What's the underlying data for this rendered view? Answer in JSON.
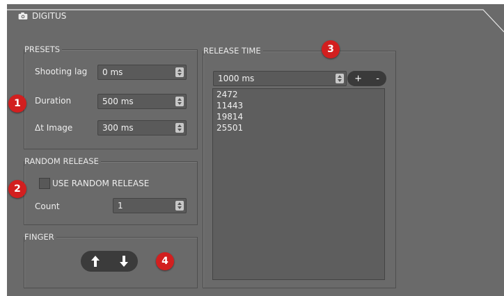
{
  "window": {
    "title": "DIGITUS",
    "title_icon": "camera-icon"
  },
  "presets": {
    "label": "PRESETS",
    "rows": [
      {
        "label": "Shooting lag",
        "value": "0 ms"
      },
      {
        "label": "Duration",
        "value": "500 ms"
      },
      {
        "label": "Δt Image",
        "value": "300 ms"
      }
    ]
  },
  "random_release": {
    "label": "RANDOM RELEASE",
    "checkbox_label": "USE RANDOM RELEASE",
    "checked": false,
    "count_label": "Count",
    "count_value": "1"
  },
  "finger": {
    "label": "FINGER",
    "up_icon": "arrow-up-icon",
    "down_icon": "arrow-down-icon"
  },
  "release_time": {
    "label": "RELEASE TIME",
    "value": "1000 ms",
    "add_label": "+",
    "remove_label": "-",
    "items": [
      "2472",
      "11443",
      "19814",
      "25501"
    ]
  },
  "badges": [
    "1",
    "2",
    "3",
    "4"
  ],
  "colors": {
    "badge": "#d21f1f",
    "panel": "#6a6a6a"
  }
}
